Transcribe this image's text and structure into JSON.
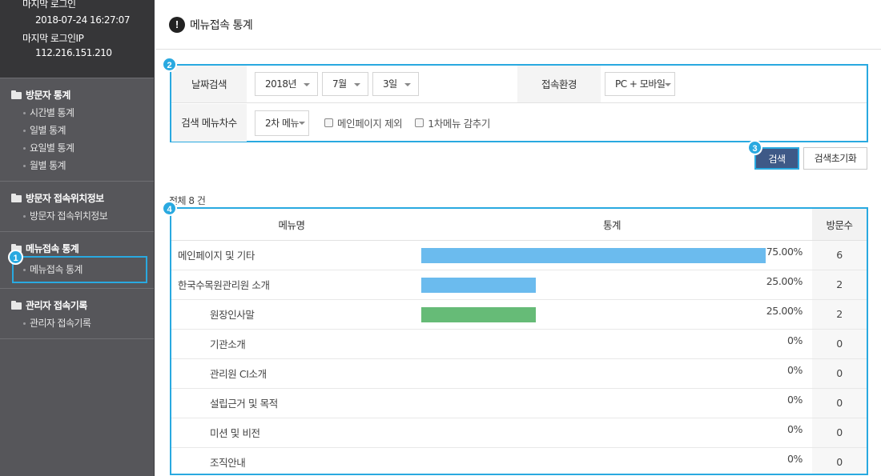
{
  "sidebar": {
    "login": {
      "last_login_label": "마지막 로그인",
      "last_login_value": "2018-07-24 16:27:07",
      "last_ip_label": "마지막 로그인IP",
      "last_ip_value": "112.216.151.210"
    },
    "groups": [
      {
        "title": "방문자 통계",
        "items": [
          "시간별 통계",
          "일별 통계",
          "요일별 통계",
          "월별 통계"
        ]
      },
      {
        "title": "방문자 접속위치정보",
        "items": [
          "방문자 접속위치정보"
        ]
      },
      {
        "title": "메뉴접속 통계",
        "items": [
          "메뉴접속 통계"
        ]
      },
      {
        "title": "관리자 접속기록",
        "items": [
          "관리자 접속기록"
        ]
      }
    ]
  },
  "page": {
    "title": "메뉴접속 통계"
  },
  "badges": [
    "1",
    "2",
    "3",
    "4"
  ],
  "search": {
    "date_label": "날짜검색",
    "year": "2018년",
    "month": "7월",
    "day": "3일",
    "env_label": "접속환경",
    "env_value": "PC + 모바일",
    "depth_label": "검색 메뉴차수",
    "depth_value": "2차 메뉴",
    "exclude_main": "메인페이지 제외",
    "hide_first": "1차메뉴 감추기",
    "search_button": "검색",
    "reset_button": "검색초기화"
  },
  "total_text": "전체 8 건",
  "table": {
    "headers": {
      "name": "메뉴명",
      "stats": "통계",
      "count": "방문수"
    },
    "rows": [
      {
        "name": "메인페이지 및 기타",
        "percent": "75.00%",
        "fill": 0.75,
        "count": "6",
        "color": "#6bbbee",
        "sub": false
      },
      {
        "name": "한국수목원관리원 소개",
        "percent": "25.00%",
        "fill": 0.25,
        "count": "2",
        "color": "#6bbbee",
        "sub": false
      },
      {
        "name": "원장인사말",
        "percent": "25.00%",
        "fill": 0.25,
        "count": "2",
        "color": "#66bb77",
        "sub": true
      },
      {
        "name": "기관소개",
        "percent": "0%",
        "fill": 0,
        "count": "0",
        "color": "#6bbbee",
        "sub": true
      },
      {
        "name": "관리원 CI소개",
        "percent": "0%",
        "fill": 0,
        "count": "0",
        "color": "#6bbbee",
        "sub": true
      },
      {
        "name": "설립근거 및 목적",
        "percent": "0%",
        "fill": 0,
        "count": "0",
        "color": "#6bbbee",
        "sub": true
      },
      {
        "name": "미션 및 비전",
        "percent": "0%",
        "fill": 0,
        "count": "0",
        "color": "#6bbbee",
        "sub": true
      },
      {
        "name": "조직안내",
        "percent": "0%",
        "fill": 0,
        "count": "0",
        "color": "#6bbbee",
        "sub": true
      }
    ]
  },
  "colors": {
    "accent": "#29a9e0",
    "search_button": "#3e5987",
    "sidebar": "#56565a"
  }
}
